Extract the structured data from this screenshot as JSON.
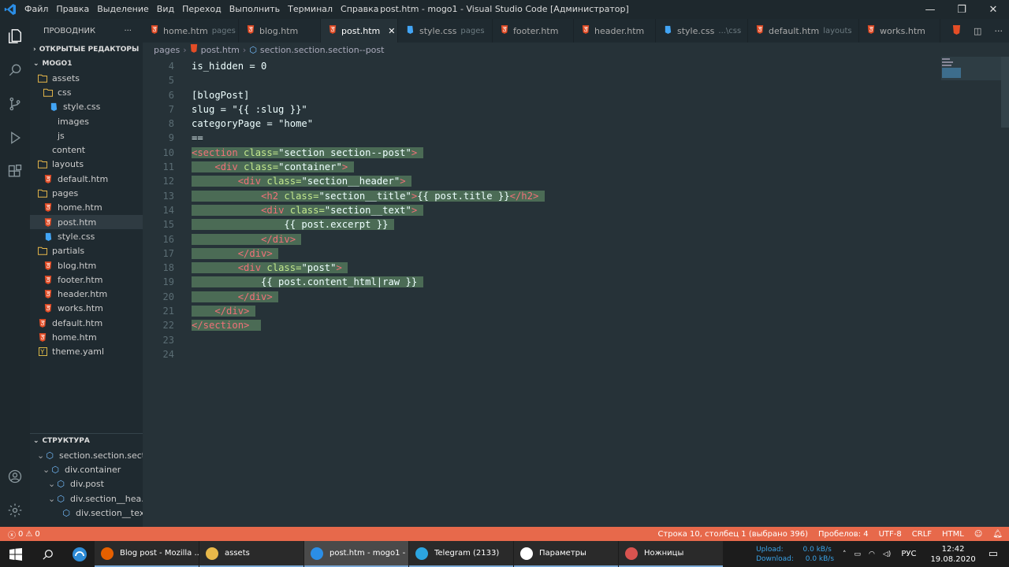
{
  "menu": [
    "Файл",
    "Правка",
    "Выделение",
    "Вид",
    "Переход",
    "Выполнить",
    "Терминал",
    "Справка"
  ],
  "window_title": "post.htm - mogo1 - Visual Studio Code [Администратор]",
  "sidebar": {
    "title": "ПРОВОДНИК",
    "more": "···",
    "open_editors": "ОТКРЫТЫЕ РЕДАКТОРЫ",
    "project": "MOGO1",
    "tree": [
      {
        "label": "assets",
        "type": "folder",
        "indent": 1
      },
      {
        "label": "css",
        "type": "folder",
        "indent": 2
      },
      {
        "label": "style.css",
        "type": "css",
        "indent": 3
      },
      {
        "label": "images",
        "type": "none",
        "indent": 2
      },
      {
        "label": "js",
        "type": "none",
        "indent": 2
      },
      {
        "label": "content",
        "type": "none",
        "indent": 1
      },
      {
        "label": "layouts",
        "type": "folder",
        "indent": 1
      },
      {
        "label": "default.htm",
        "type": "html",
        "indent": 2
      },
      {
        "label": "pages",
        "type": "folder",
        "indent": 1
      },
      {
        "label": "home.htm",
        "type": "html",
        "indent": 2
      },
      {
        "label": "post.htm",
        "type": "html",
        "indent": 2,
        "active": true
      },
      {
        "label": "style.css",
        "type": "css",
        "indent": 2
      },
      {
        "label": "partials",
        "type": "folder",
        "indent": 1
      },
      {
        "label": "blog.htm",
        "type": "html",
        "indent": 2
      },
      {
        "label": "footer.htm",
        "type": "html",
        "indent": 2
      },
      {
        "label": "header.htm",
        "type": "html",
        "indent": 2
      },
      {
        "label": "works.htm",
        "type": "html",
        "indent": 2
      },
      {
        "label": "default.htm",
        "type": "html",
        "indent": 1
      },
      {
        "label": "home.htm",
        "type": "html",
        "indent": 1
      },
      {
        "label": "theme.yaml",
        "type": "yaml",
        "indent": 1
      }
    ],
    "outline_title": "СТРУКТУРА",
    "outline": [
      {
        "label": "section.section.sect...",
        "indent": 1
      },
      {
        "label": "div.container",
        "indent": 2
      },
      {
        "label": "div.post",
        "indent": 3
      },
      {
        "label": "div.section__hea...",
        "indent": 3
      },
      {
        "label": "div.section__text",
        "indent": 4
      }
    ]
  },
  "tabs": [
    {
      "label": "home.htm",
      "desc": "pages",
      "type": "html"
    },
    {
      "label": "blog.htm",
      "desc": "",
      "type": "html"
    },
    {
      "label": "post.htm",
      "desc": "",
      "type": "html",
      "active": true
    },
    {
      "label": "style.css",
      "desc": "pages",
      "type": "css"
    },
    {
      "label": "footer.htm",
      "desc": "",
      "type": "html"
    },
    {
      "label": "header.htm",
      "desc": "",
      "type": "html"
    },
    {
      "label": "style.css",
      "desc": "...\\css",
      "type": "css"
    },
    {
      "label": "default.htm",
      "desc": "layouts",
      "type": "html"
    },
    {
      "label": "works.htm",
      "desc": "",
      "type": "html"
    }
  ],
  "breadcrumb": [
    "pages",
    "post.htm",
    "section.section.section--post"
  ],
  "editor": {
    "line_numbers": [
      "4",
      "5",
      "6",
      "7",
      "8",
      "9",
      "10",
      "11",
      "12",
      "13",
      "14",
      "15",
      "16",
      "17",
      "18",
      "19",
      "20",
      "21",
      "22",
      "23",
      "24"
    ]
  },
  "status": {
    "errors": "0",
    "warnings": "0",
    "position": "Строка 10, столбец 1 (выбрано 396)",
    "spaces": "Пробелов: 4",
    "encoding": "UTF-8",
    "eol": "CRLF",
    "language": "HTML"
  },
  "taskbar": {
    "apps": [
      {
        "label": "Blog post - Mozilla ...",
        "icon": "firefox-icon",
        "color": "#e66000"
      },
      {
        "label": "assets",
        "icon": "folder-icon",
        "color": "#e8b84a"
      },
      {
        "label": "post.htm - mogo1 - ...",
        "icon": "vscode-icon",
        "color": "#2b8ee6",
        "active": true
      },
      {
        "label": "Telegram (2133)",
        "icon": "telegram-icon",
        "color": "#2ca5e0"
      },
      {
        "label": "Параметры",
        "icon": "gear-icon",
        "color": "#ffffff"
      },
      {
        "label": "Ножницы",
        "icon": "scissors-icon",
        "color": "#d9534f"
      }
    ],
    "upload_label": "Upload:",
    "upload_value": "0.0 kB/s",
    "download_label": "Download:",
    "download_value": "0.0 kB/s",
    "lang": "РУС",
    "time": "12:42",
    "date": "19.08.2020"
  },
  "colors": {
    "accent_status": "#e7694b",
    "selection": "#4b6b55",
    "tag": "#f07178",
    "attr": "#c3e88d",
    "html_icon": "#e44d26",
    "css_icon": "#42a5f5",
    "folder_icon": "#e8b84a"
  }
}
